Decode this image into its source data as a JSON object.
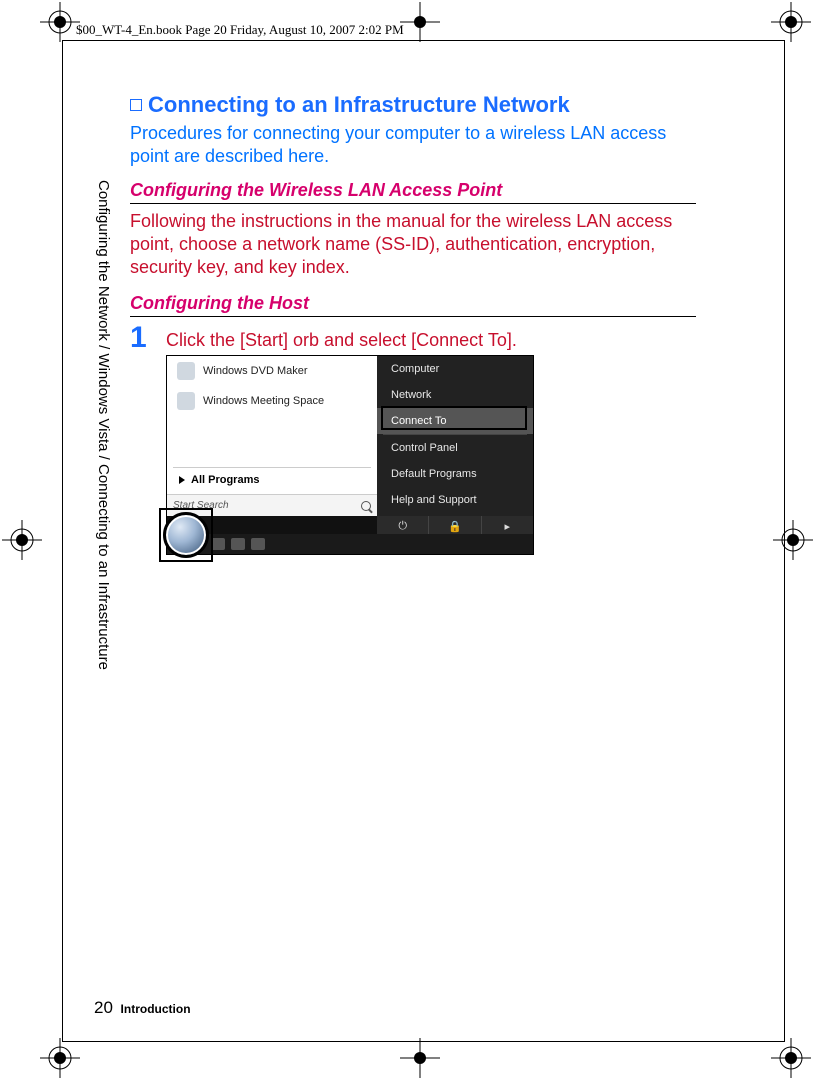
{
  "header_line": "$00_WT-4_En.book  Page 20  Friday, August 10, 2007  2:02 PM",
  "title": "Connecting to an Infrastructure Network",
  "intro": "Procedures for connecting your computer to a wireless LAN access point are described here.",
  "section1_title": "Configuring the Wireless LAN Access Point",
  "section1_body": "Following the instructions in the manual for the wireless LAN access point, choose a network name (SS-ID), authentication, encryption, security key, and key index.",
  "section2_title": "Configuring the Host",
  "step1_num": "1",
  "step1_text": "Click the [Start] orb and select [Connect To].",
  "side_label": "Configuring the Network / Windows Vista / Connecting to an Infrastructure",
  "footer_page": "20",
  "footer_section": "Introduction",
  "startmenu": {
    "left_items": [
      "Windows DVD Maker",
      "Windows Meeting Space"
    ],
    "all_programs": "All Programs",
    "search_placeholder": "Start Search",
    "right_items": [
      "Computer",
      "Network",
      "Connect To",
      "Control Panel",
      "Default Programs",
      "Help and Support"
    ],
    "power_icons": [
      "⏻",
      "🔒",
      "▸"
    ]
  }
}
